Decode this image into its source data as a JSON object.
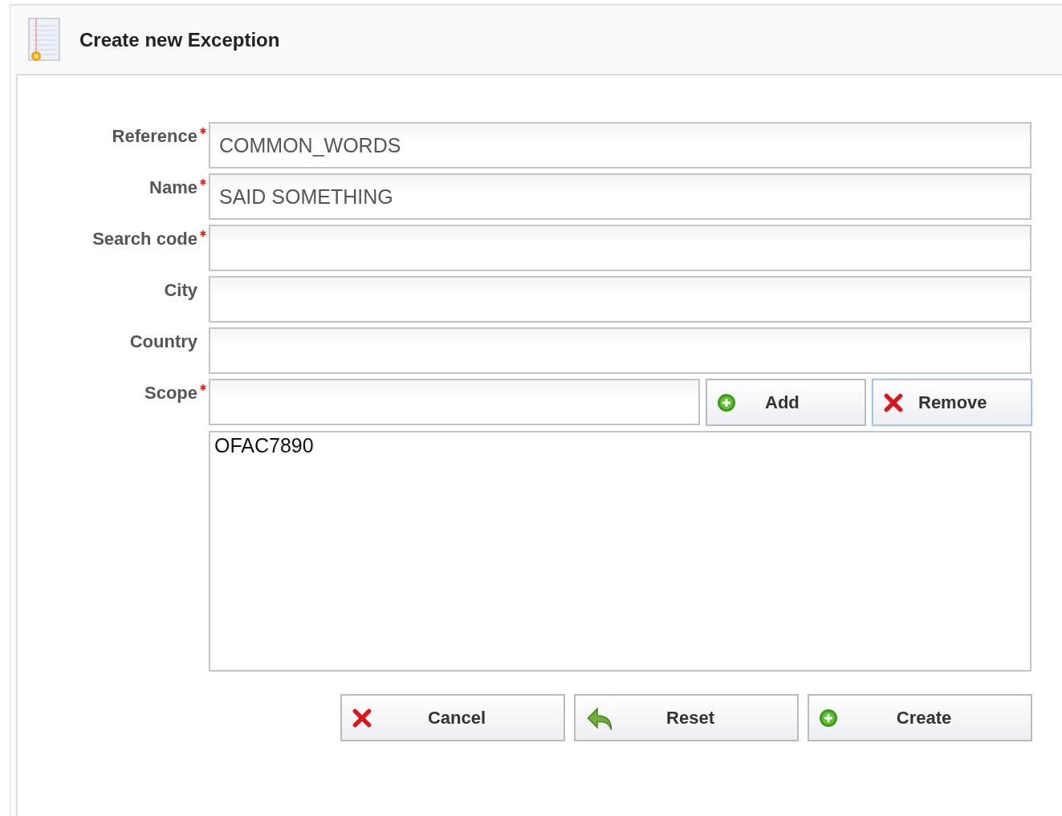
{
  "window": {
    "title": "Create new Exception"
  },
  "fields": [
    {
      "label": "Reference",
      "required": true,
      "value": "COMMON_WORDS"
    },
    {
      "label": "Name",
      "required": true,
      "value": "SAID SOMETHING"
    },
    {
      "label": "Search code",
      "required": true
    },
    {
      "label": "City",
      "required": false
    },
    {
      "label": "Country",
      "required": false
    }
  ],
  "scope": {
    "label": "Scope",
    "required": true,
    "buttons": [
      {
        "kind": "add",
        "label": "Add",
        "focused": false
      },
      {
        "kind": "remove",
        "label": "Remove",
        "focused": true
      }
    ],
    "items": [
      "OFAC7890"
    ]
  },
  "actions": [
    {
      "kind": "remove",
      "label": "Cancel"
    },
    {
      "kind": "undo",
      "label": "Reset"
    },
    {
      "kind": "add",
      "label": "Create"
    }
  ]
}
